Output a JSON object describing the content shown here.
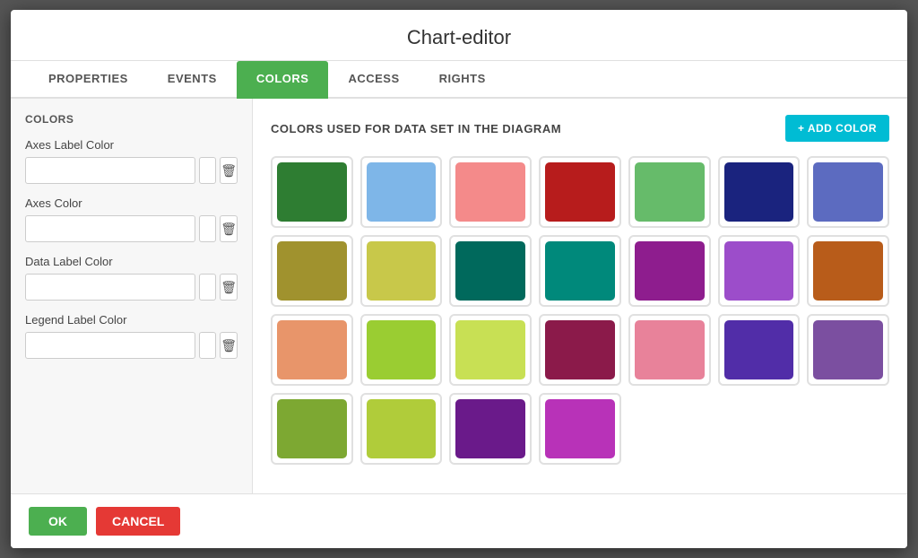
{
  "modal": {
    "title": "Chart-editor"
  },
  "tabs": [
    {
      "id": "properties",
      "label": "PROPERTIES",
      "active": false
    },
    {
      "id": "events",
      "label": "EVENTS",
      "active": false
    },
    {
      "id": "colors",
      "label": "COLORS",
      "active": true
    },
    {
      "id": "access",
      "label": "ACCESS",
      "active": false
    },
    {
      "id": "rights",
      "label": "RIGHTS",
      "active": false
    }
  ],
  "left_panel": {
    "title": "COLORS",
    "fields": [
      {
        "id": "axes-label-color",
        "label": "Axes Label Color"
      },
      {
        "id": "axes-color",
        "label": "Axes Color"
      },
      {
        "id": "data-label-color",
        "label": "Data Label Color"
      },
      {
        "id": "legend-label-color",
        "label": "Legend Label Color"
      }
    ]
  },
  "right_panel": {
    "title": "COLORS USED FOR DATA SET IN THE DIAGRAM",
    "add_button": "+ ADD COLOR",
    "swatches": [
      "#2e7d32",
      "#7eb6e8",
      "#f48a8a",
      "#b71c1c",
      "#66bb6a",
      "#1a237e",
      "#5c6bc0",
      "#a0922e",
      "#c8c84a",
      "#00695c",
      "#00897b",
      "#8e1d8e",
      "#9c4dca",
      "#b85c1a",
      "#e8956a",
      "#9acd32",
      "#c8e054",
      "#8b1a4a",
      "#e8829a",
      "#512da8",
      "#7b4fa0",
      "#7da832",
      "#b0cc3a",
      "#6a1a8a",
      "#b832b8"
    ]
  },
  "footer": {
    "ok_label": "OK",
    "cancel_label": "CANCEL"
  },
  "colors": {
    "active_tab_bg": "#4caf50",
    "add_color_btn_bg": "#00bcd4",
    "ok_btn_bg": "#4caf50",
    "cancel_btn_bg": "#e53935"
  }
}
